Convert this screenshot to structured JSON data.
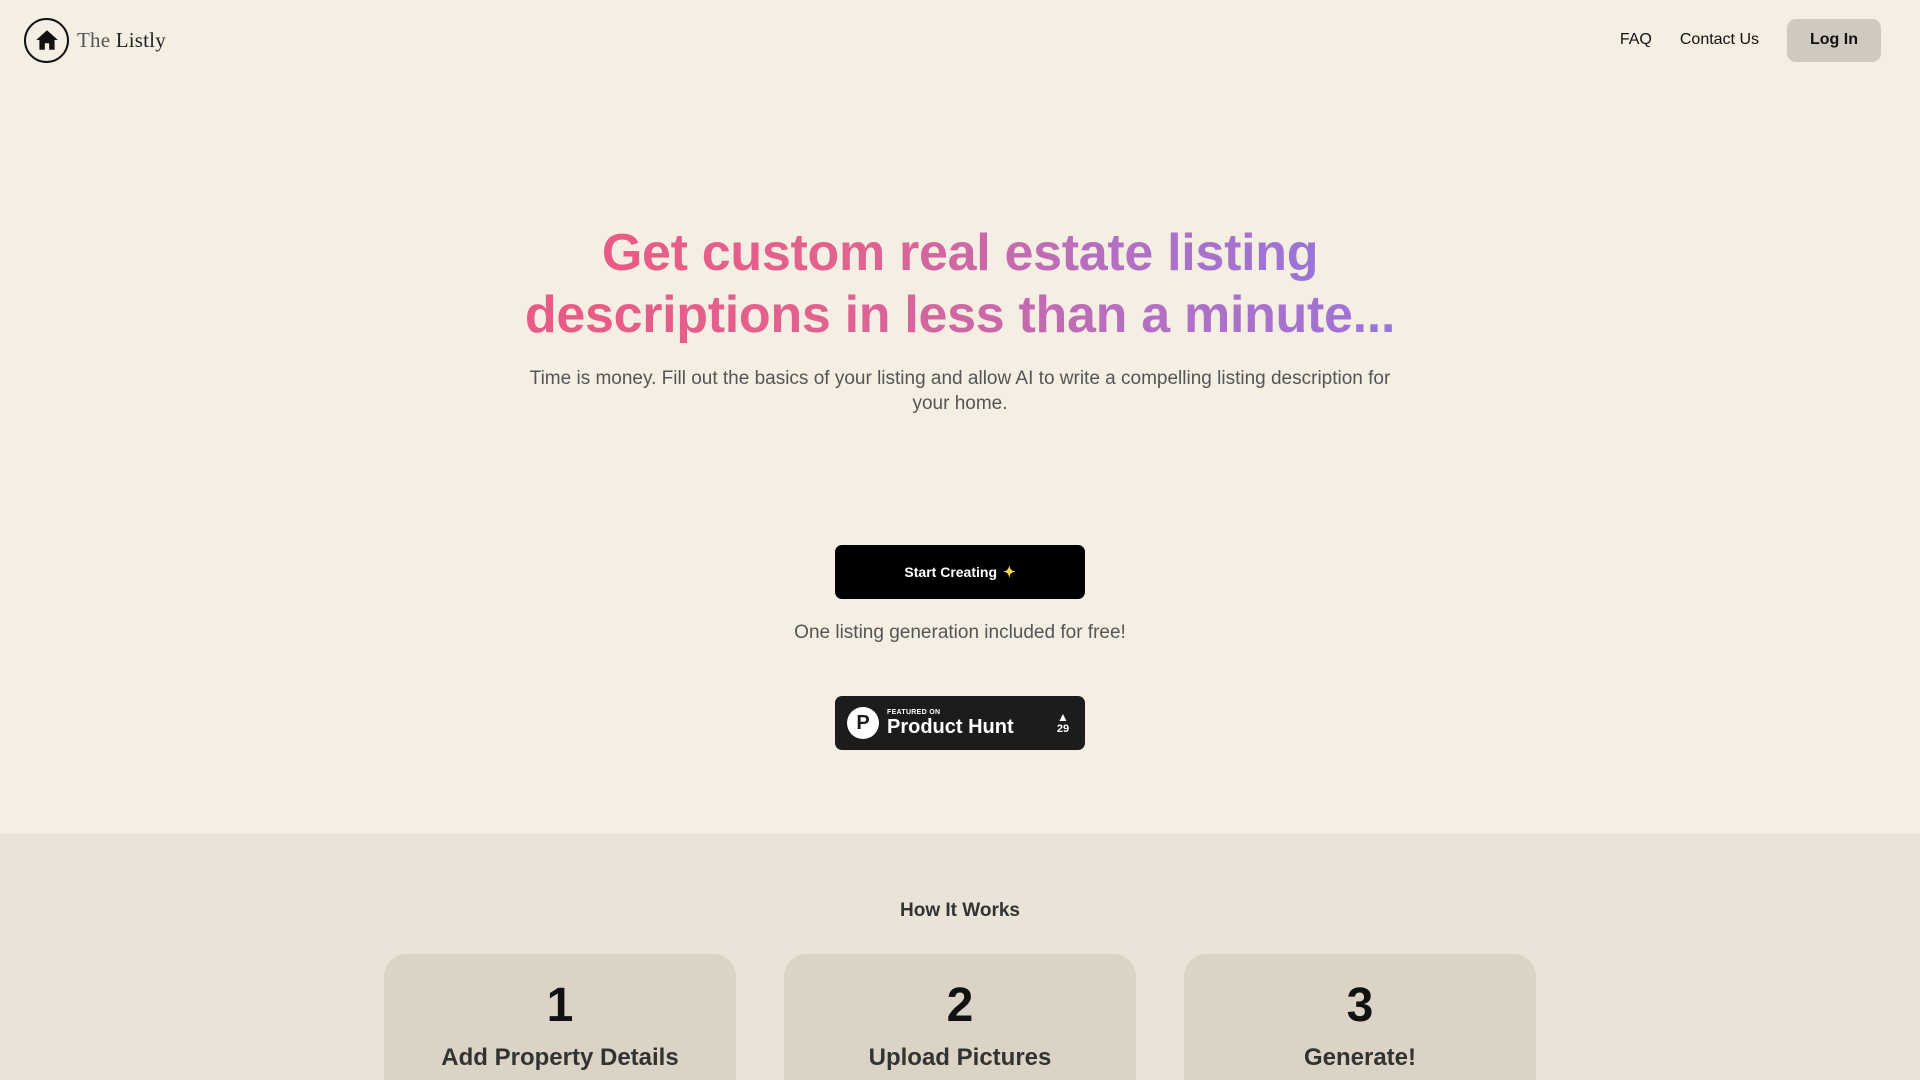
{
  "header": {
    "brand_the": "The",
    "brand_name": "Listly",
    "nav_faq": "FAQ",
    "nav_contact": "Contact Us",
    "login_label": "Log In"
  },
  "hero": {
    "title_line1": "Get custom real estate listing",
    "title_line2": "descriptions in less than a minute...",
    "subtitle": "Time is money. Fill out the basics of your listing and allow AI to write a compelling listing description for your home.",
    "cta_label": "Start Creating",
    "cta_icon": "sparkle-icon",
    "free_note": "One listing generation included for free!"
  },
  "product_hunt": {
    "featured_on": "FEATURED ON",
    "name": "Product Hunt",
    "logo_letter": "P",
    "upvotes": "29"
  },
  "how_it_works": {
    "title": "How It Works",
    "steps": [
      {
        "number": "1",
        "label": "Add Property Details"
      },
      {
        "number": "2",
        "label": "Upload Pictures"
      },
      {
        "number": "3",
        "label": "Generate!"
      }
    ]
  },
  "colors": {
    "background": "#f5eee3",
    "section_background": "#e9e4d7",
    "card_background": "#dbd4c6",
    "gradient_start": "#ea5a86",
    "gradient_end": "#9a74d8",
    "cta_background": "#000000"
  }
}
